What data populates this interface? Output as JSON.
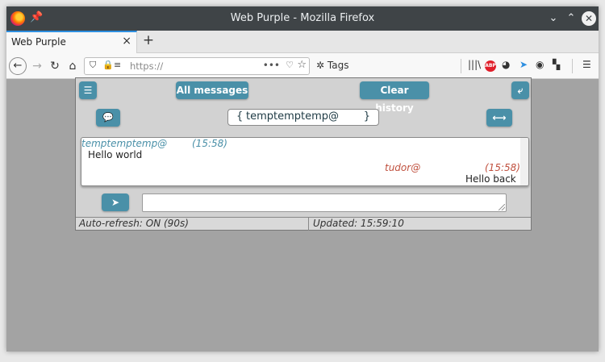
{
  "window": {
    "title": "Web Purple - Mozilla Firefox",
    "minimize_glyph": "⌄",
    "maximize_glyph": "⌃",
    "close_glyph": "✕"
  },
  "tabs": [
    {
      "label": "Web Purple",
      "close_glyph": "×"
    }
  ],
  "new_tab_glyph": "+",
  "nav": {
    "url_value": "https://",
    "dots_glyph": "•••",
    "tags_label": "Tags"
  },
  "app": {
    "accent_color": "#4a90a8",
    "menu_glyph": "☰",
    "all_messages_label": "All messages",
    "clear_history_label": "Clear history",
    "refresh_glyph": "⤶",
    "chat_glyph": "💬",
    "swap_glyph": "⟷",
    "contact": {
      "open": "{",
      "name": "temptemptemp@",
      "close": "}"
    },
    "messages": [
      {
        "sender": "temptemptemp@",
        "time": "(15:58)",
        "text": "Hello world",
        "color": "#4a90a8"
      },
      {
        "sender": "tudor@",
        "time": "(15:58)",
        "text": "Hello back",
        "color": "#c0503e"
      }
    ],
    "send_glyph": "➤",
    "compose_value": "",
    "status": {
      "auto_refresh": "Auto-refresh: ON (90s)",
      "updated": "Updated: 15:59:10"
    }
  }
}
